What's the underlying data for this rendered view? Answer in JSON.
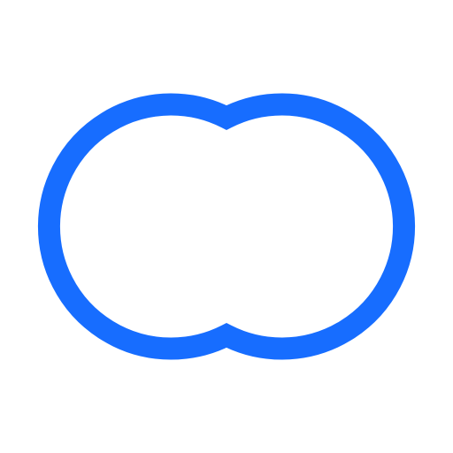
{
  "icon": {
    "name": "double-circle-outline-icon",
    "stroke_color": "#176DFF",
    "fill_color": "#FFFFFF",
    "background_color": "#FFFFFF"
  }
}
